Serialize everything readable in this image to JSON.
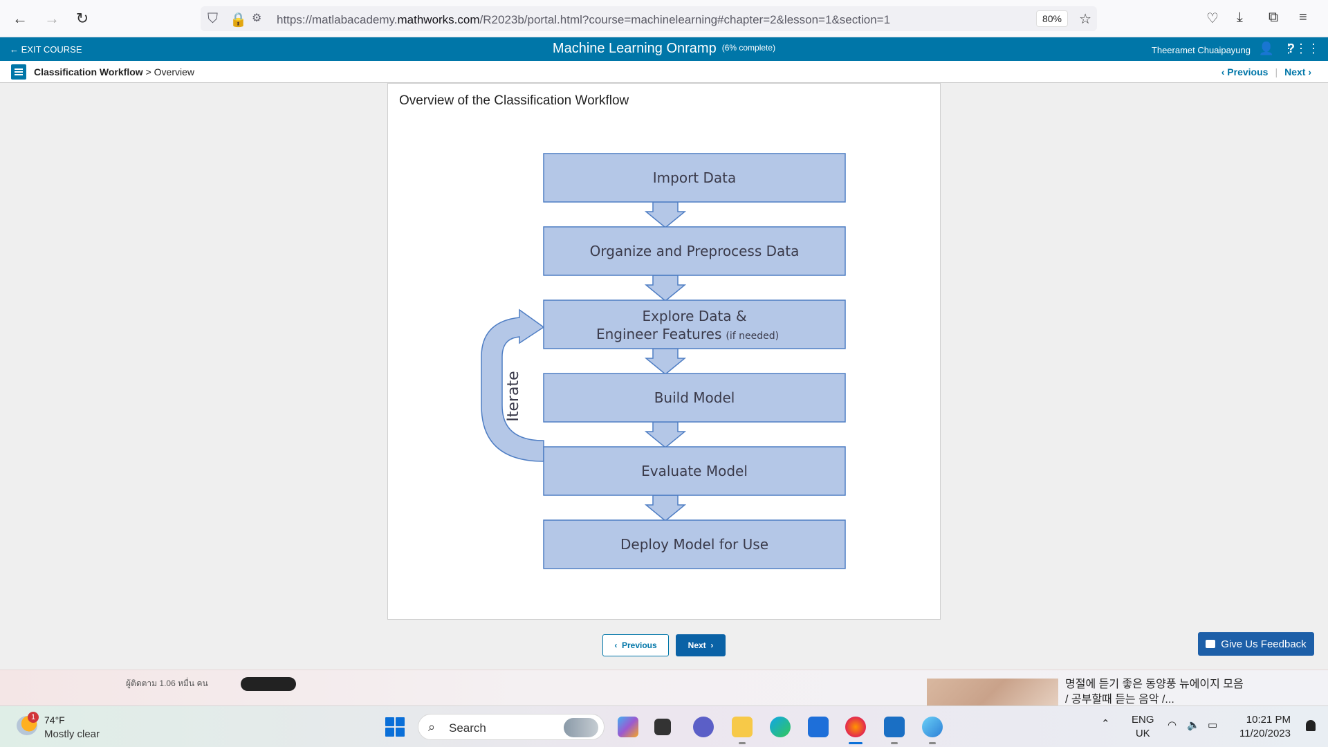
{
  "browser": {
    "url_prefix": "https://matlabacademy.",
    "url_domain": "mathworks.com",
    "url_suffix": "/R2023b/portal.html?course=machinelearning#chapter=2&lesson=1&section=1",
    "zoom": "80%"
  },
  "course": {
    "exit_label": "EXIT COURSE",
    "title": "Machine Learning Onramp",
    "progress": "(6% complete)",
    "user": "Theeramet Chuaipayung"
  },
  "breadcrumb": {
    "section": "Classification Workflow",
    "separator": ">",
    "page": "Overview",
    "previous": "Previous",
    "next": "Next"
  },
  "content": {
    "title": "Overview of the Classification Workflow",
    "steps": [
      {
        "label": "Import Data"
      },
      {
        "label": "Organize and Preprocess Data"
      },
      {
        "label": "Explore Data &",
        "label2": "Engineer Features",
        "note": "(if needed)"
      },
      {
        "label": "Build Model"
      },
      {
        "label": "Evaluate Model"
      },
      {
        "label": "Deploy Model for Use"
      }
    ],
    "loop_label": "Iterate",
    "colors": {
      "box_fill": "#b4c7e7",
      "box_stroke": "#4f7ec4",
      "text": "#3a3a4a"
    }
  },
  "footer_nav": {
    "previous": "Previous",
    "next": "Next",
    "feedback": "Give Us Feedback"
  },
  "strip": {
    "left_text": "ผู้ติดตาม 1.06 หมื่น คน",
    "right_text": "명절에 듣기 좋은 동양풍 뉴에이지 모음 / 공부할때 듣는 음악 /..."
  },
  "taskbar": {
    "weather_badge": "1",
    "temperature": "74°F",
    "weather": "Mostly clear",
    "search_label": "Search",
    "lang1": "ENG",
    "lang2": "UK",
    "time": "10:21 PM",
    "date": "11/20/2023"
  }
}
